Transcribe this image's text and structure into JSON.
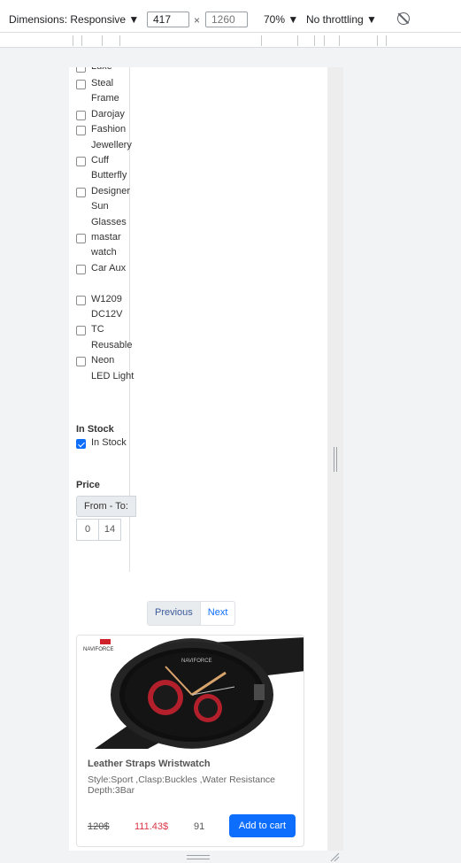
{
  "devtools": {
    "dimensions": "Dimensions: Responsive ▼",
    "width": "417",
    "height_placeholder": "1260",
    "times": "×",
    "zoom": "70% ▼",
    "throttling": "No throttling ▼"
  },
  "filters": [
    {
      "label": "Luxe",
      "checked": false
    },
    {
      "label": "Steal Frame",
      "checked": false
    },
    {
      "label": "Darojay",
      "checked": false
    },
    {
      "label": "Fashion Jewellery",
      "checked": false
    },
    {
      "label": "Cuff Butterfly",
      "checked": false
    },
    {
      "label": "Designer Sun Glasses",
      "checked": false
    },
    {
      "label": "mastar watch",
      "checked": false
    },
    {
      "label": "Car Aux",
      "checked": false
    },
    {
      "label": "W1209 DC12V",
      "checked": false
    },
    {
      "label": "TC Reusable",
      "checked": false
    },
    {
      "label": "Neon LED Light",
      "checked": false
    }
  ],
  "stock": {
    "title": "In Stock",
    "option": "In Stock",
    "checked": true
  },
  "price": {
    "title": "Price",
    "addon": "From - To:",
    "from": "0",
    "to": "14"
  },
  "pagination": {
    "previous": "Previous",
    "next": "Next"
  },
  "product": {
    "brand": "NAVIFORCE",
    "name": "Leather Straps Wristwatch",
    "description": "Style:Sport ,Clasp:Buckles ,Water Resistance Depth:3Bar",
    "old_price": "120$",
    "new_price": "111.43$",
    "quantity": "91",
    "cart_label": "Add to cart"
  },
  "colors": {
    "accent": "#0d6efd",
    "sale": "#dc3545"
  }
}
